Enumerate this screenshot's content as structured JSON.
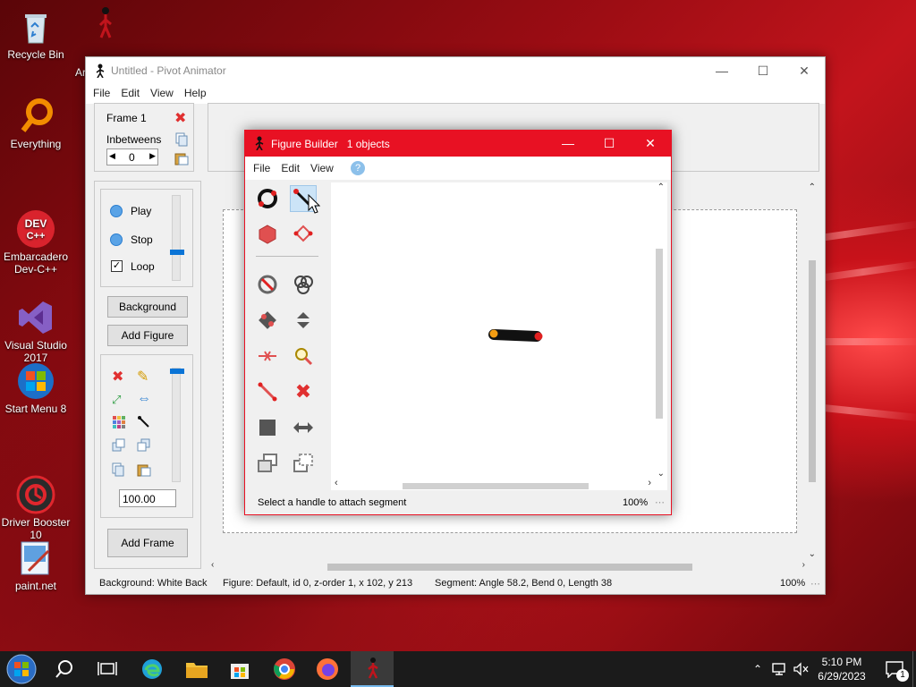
{
  "desktop": {
    "icons": [
      {
        "label": "Recycle Bin"
      },
      {
        "label": "Everything"
      },
      {
        "label": "Embarcadero\nDev-C++"
      },
      {
        "label": "Visual Studio\n2017"
      },
      {
        "label": "Start Menu 8"
      },
      {
        "label": "Driver Booster\n10"
      },
      {
        "label": "paint.net"
      }
    ],
    "partial_label": "Ar"
  },
  "main": {
    "title": "Untitled - Pivot Animator",
    "menu": [
      "File",
      "Edit",
      "View",
      "Help"
    ],
    "frame_label": "Frame 1",
    "inbetweens_label": "Inbetweens",
    "inbetweens_value": "0",
    "play_label": "Play",
    "stop_label": "Stop",
    "loop_label": "Loop",
    "background_button": "Background",
    "add_figure_button": "Add Figure",
    "scale_value": "100.00",
    "add_frame_button": "Add Frame",
    "status": {
      "background": "Background: White Back",
      "figure": "Figure: Default,  id 0,  z-order 1,  x 102, y 213",
      "segment": "Segment: Angle 58.2,  Bend 0,  Length 38",
      "zoom": "100%"
    }
  },
  "figure_builder": {
    "title": "Figure Builder",
    "objects": "1 objects",
    "menu": [
      "File",
      "Edit",
      "View"
    ],
    "status_text": "Select a handle to attach segment",
    "zoom": "100%"
  },
  "taskbar": {
    "time": "5:10 PM",
    "date": "6/29/2023",
    "notification_count": "1"
  },
  "colors": {
    "accent_red": "#e81123",
    "handle_red": "#e02020",
    "handle_orange": "#f39c12",
    "slider_blue": "#0a74d6"
  }
}
